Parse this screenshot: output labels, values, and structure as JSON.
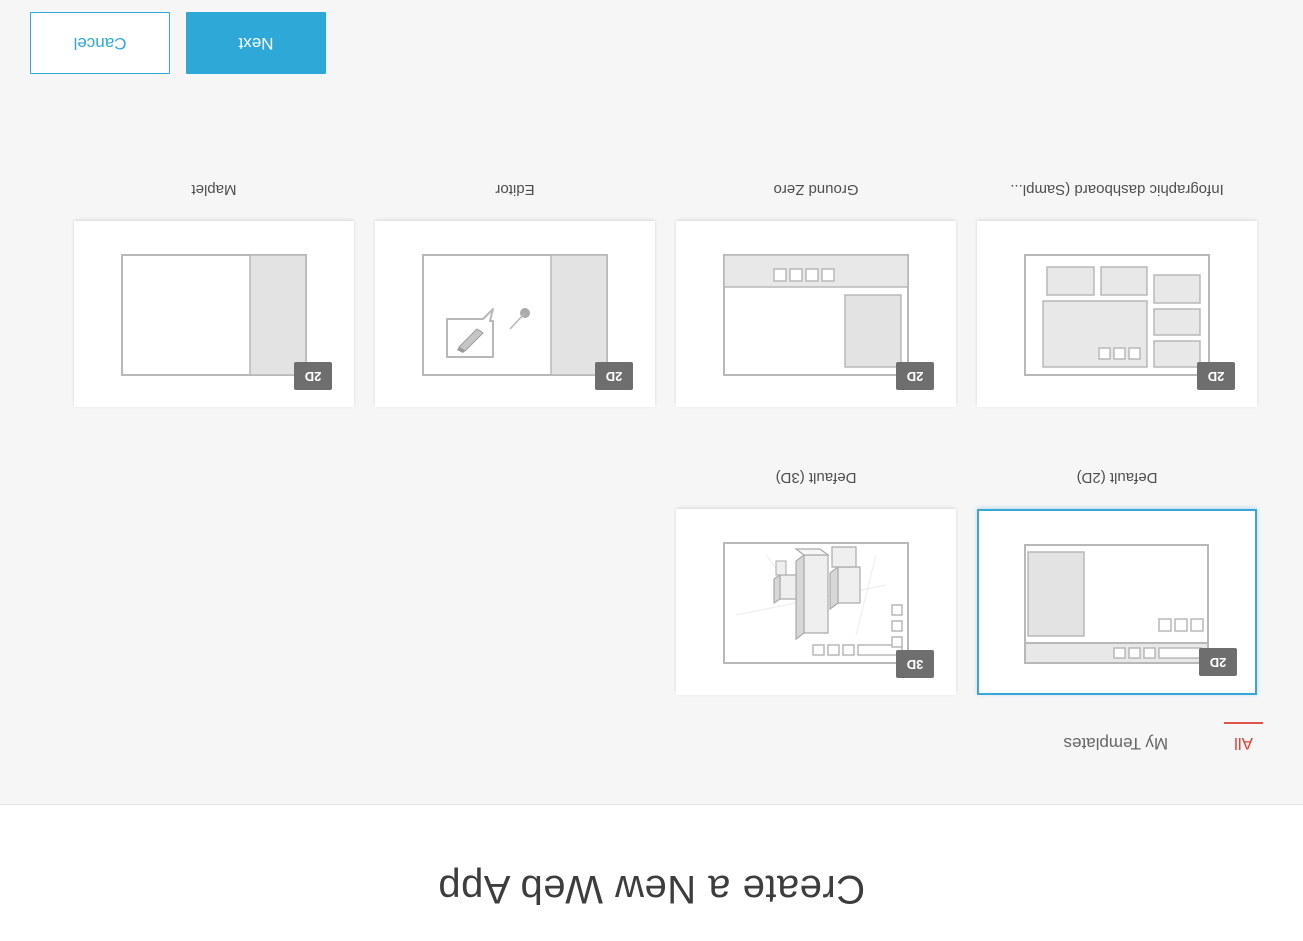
{
  "dialog": {
    "title": "Create a New Web App"
  },
  "tabs": [
    {
      "label": "All",
      "active": true
    },
    {
      "label": "My Templates",
      "active": false
    }
  ],
  "templates": [
    {
      "name": "Default (2D)",
      "badge": "2D",
      "selected": true,
      "icon": "default-2d-layout-icon"
    },
    {
      "name": "Default (3D)",
      "badge": "3D",
      "selected": false,
      "icon": "default-3d-scene-icon"
    },
    {
      "name": "Infographic dashboard (Sampl...",
      "badge": "2D",
      "selected": false,
      "icon": "dashboard-layout-icon"
    },
    {
      "name": "Ground Zero",
      "badge": "2D",
      "selected": false,
      "icon": "ground-zero-layout-icon"
    },
    {
      "name": "Editor",
      "badge": "2D",
      "selected": false,
      "icon": "editor-layout-icon"
    },
    {
      "name": "Maplet",
      "badge": "2D",
      "selected": false,
      "icon": "maplet-layout-icon"
    }
  ],
  "footer": {
    "next_label": "Next",
    "cancel_label": "Cancel"
  },
  "colors": {
    "accent": "#2ea8d6",
    "active_tab": "#e0534a",
    "badge": "#6e6e6e"
  }
}
